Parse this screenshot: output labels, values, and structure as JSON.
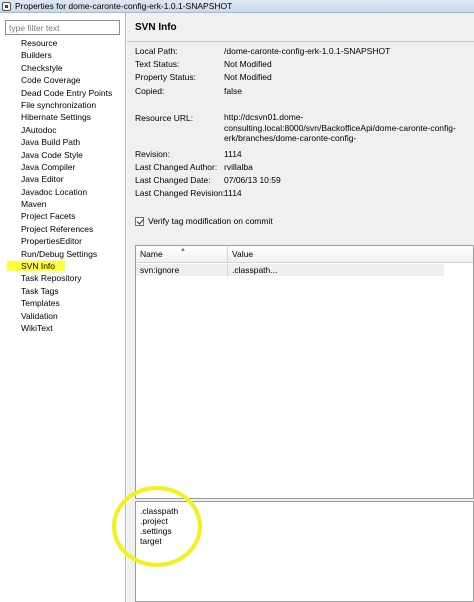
{
  "window": {
    "title": "Properties for dome-caronte-config-erk-1.0.1-SNAPSHOT"
  },
  "filter": {
    "placeholder": "type filter text",
    "value": ""
  },
  "nav": {
    "items": [
      "Resource",
      "Builders",
      "Checkstyle",
      "Code Coverage",
      "Dead Code Entry Points",
      "File synchronization",
      "Hibernate Settings",
      "JAutodoc",
      "Java Build Path",
      "Java Code Style",
      "Java Compiler",
      "Java Editor",
      "Javadoc Location",
      "Maven",
      "Project Facets",
      "Project References",
      "PropertiesEditor",
      "Run/Debug Settings",
      "SVN Info",
      "Task Repository",
      "Task Tags",
      "Templates",
      "Validation",
      "WikiText"
    ],
    "selected": "SVN Info"
  },
  "svn": {
    "title": "SVN Info",
    "local_path_label": "Local Path:",
    "local_path_value": "/dome-caronte-config-erk-1.0.1-SNAPSHOT",
    "text_status_label": "Text Status:",
    "text_status_value": "Not Modified",
    "property_status_label": "Property Status:",
    "property_status_value": "Not Modified",
    "copied_label": "Copied:",
    "copied_value": "false",
    "resource_url_label": "Resource URL:",
    "resource_url_value": "http://dcsvn01.dome-consulting.local:8000/svn/BackofficeApi/dome-caronte-config-erk/branches/dome-caronte-config-",
    "revision_label": "Revision:",
    "revision_value": "1114",
    "last_changed_author_label": "Last Changed Author:",
    "last_changed_author_value": "rvillalba",
    "last_changed_date_label": "Last Changed Date:",
    "last_changed_date_value": "07/06/13 10:59",
    "last_changed_revision_label": "Last Changed Revision:",
    "last_changed_revision_value": "1114",
    "verify_label": "Verify tag modification on commit",
    "verify_checked": true
  },
  "props_table": {
    "columns": [
      "Name",
      "Value"
    ],
    "rows": [
      {
        "name": "svn:ignore",
        "value": ".classpath..."
      }
    ]
  },
  "value_box": {
    "lines": [
      ".classpath",
      ".project",
      ".settings",
      "target"
    ]
  },
  "colors": {
    "selection_highlight": "#ffff33",
    "annotation_circle": "#f5ef1a"
  }
}
